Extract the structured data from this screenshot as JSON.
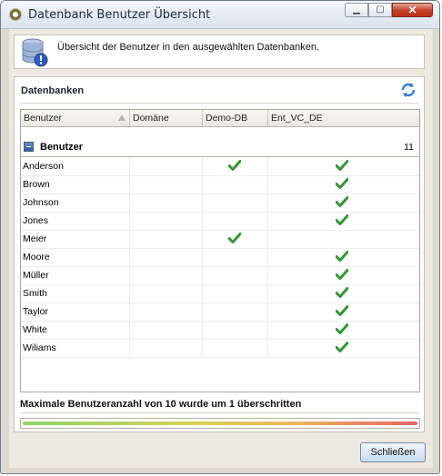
{
  "window": {
    "title": "Datenbank Benutzer Übersicht",
    "controls": {
      "minimize": "▁",
      "maximize": "▢",
      "close": "✕"
    }
  },
  "info": {
    "text": "Übersicht der Benutzer in den ausgewählten Datenbanken.",
    "icon": "database-warning-icon"
  },
  "section": {
    "title": "Datenbanken",
    "refresh_icon": "refresh-icon"
  },
  "grid": {
    "columns": [
      "Benutzer",
      "Domäne",
      "Demo-DB",
      "Ent_VC_DE"
    ],
    "sort_column": "Benutzer",
    "group": {
      "label": "Benutzer",
      "count": "11",
      "expanded": true
    },
    "rows": [
      {
        "name": "Anderson",
        "domain": "",
        "demo_db": true,
        "ent_vc_de": true
      },
      {
        "name": "Brown",
        "domain": "",
        "demo_db": false,
        "ent_vc_de": true
      },
      {
        "name": "Johnson",
        "domain": "",
        "demo_db": false,
        "ent_vc_de": true
      },
      {
        "name": "Jones",
        "domain": "",
        "demo_db": false,
        "ent_vc_de": true
      },
      {
        "name": "Meier",
        "domain": "",
        "demo_db": true,
        "ent_vc_de": false
      },
      {
        "name": "Moore",
        "domain": "",
        "demo_db": false,
        "ent_vc_de": true
      },
      {
        "name": "Müller",
        "domain": "",
        "demo_db": false,
        "ent_vc_de": true
      },
      {
        "name": "Smith",
        "domain": "",
        "demo_db": false,
        "ent_vc_de": true
      },
      {
        "name": "Taylor",
        "domain": "",
        "demo_db": false,
        "ent_vc_de": true
      },
      {
        "name": "White",
        "domain": "",
        "demo_db": false,
        "ent_vc_de": true
      },
      {
        "name": "Wiliams",
        "domain": "",
        "demo_db": false,
        "ent_vc_de": true
      }
    ]
  },
  "warning": {
    "text": "Maximale Benutzeranzahl von 10 wurde um 1 überschritten",
    "progress_fraction": 1.0
  },
  "footer": {
    "close_label": "Schließen"
  },
  "colors": {
    "check": "#2e9a2e",
    "accent": "#2e5aa0"
  }
}
